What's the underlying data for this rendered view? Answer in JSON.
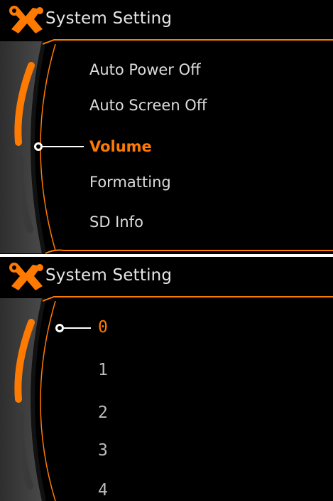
{
  "theme": {
    "accent": "#ff7a00",
    "text": "#dcdcdc",
    "background": "#000000"
  },
  "screens": [
    {
      "title": "System Setting",
      "icon": "wrench-screwdriver-icon",
      "items": [
        {
          "label": "Auto Power Off",
          "selected": false
        },
        {
          "label": "Auto Screen Off",
          "selected": false
        },
        {
          "label": "Volume",
          "selected": true
        },
        {
          "label": "Formatting",
          "selected": false
        },
        {
          "label": "SD Info",
          "selected": false
        }
      ]
    },
    {
      "title": "System Setting",
      "icon": "wrench-screwdriver-icon",
      "items": [
        {
          "label": "0",
          "selected": true
        },
        {
          "label": "1",
          "selected": false
        },
        {
          "label": "2",
          "selected": false
        },
        {
          "label": "3",
          "selected": false
        },
        {
          "label": "4",
          "selected": false
        }
      ]
    }
  ]
}
